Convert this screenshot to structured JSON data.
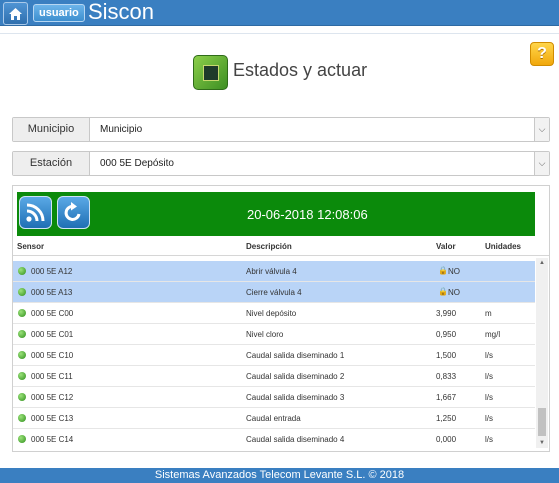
{
  "header": {
    "home_icon": "home-icon",
    "user_label": "usuario",
    "app_title": "Siscon",
    "help_label": "?"
  },
  "page": {
    "icon": "circuit-board-icon",
    "title": "Estados y actuar"
  },
  "filters": {
    "municipio": {
      "label": "Municipio",
      "value": "Municipio"
    },
    "estacion": {
      "label": "Estación",
      "value": "000 5E Depósito"
    }
  },
  "panel": {
    "datetime": "20-06-2018 12:08:06",
    "columns": {
      "sensor": "Sensor",
      "descripcion": "Descripción",
      "valor": "Valor",
      "unidades": "Unidades"
    },
    "rows": [
      {
        "sensor": "000 5E A12",
        "descripcion": "Abrir válvula 4",
        "valor": "NO",
        "unidades": "",
        "selected": true,
        "locked": true
      },
      {
        "sensor": "000 5E A13",
        "descripcion": "Cierre válvula 4",
        "valor": "NO",
        "unidades": "",
        "selected": true,
        "locked": true
      },
      {
        "sensor": "000 5E C00",
        "descripcion": "Nivel depósito",
        "valor": "3,990",
        "unidades": "m"
      },
      {
        "sensor": "000 5E C01",
        "descripcion": "Nivel cloro",
        "valor": "0,950",
        "unidades": "mg/l"
      },
      {
        "sensor": "000 5E C10",
        "descripcion": "Caudal salida diseminado 1",
        "valor": "1,500",
        "unidades": "l/s"
      },
      {
        "sensor": "000 5E C11",
        "descripcion": "Caudal salida diseminado 2",
        "valor": "0,833",
        "unidades": "l/s"
      },
      {
        "sensor": "000 5E C12",
        "descripcion": "Caudal salida diseminado 3",
        "valor": "1,667",
        "unidades": "l/s"
      },
      {
        "sensor": "000 5E C13",
        "descripcion": "Caudal entrada",
        "valor": "1,250",
        "unidades": "l/s"
      },
      {
        "sensor": "000 5E C14",
        "descripcion": "Caudal salida diseminado 4",
        "valor": "0,000",
        "unidades": "l/s"
      }
    ]
  },
  "footer": {
    "text": "Sistemas Avanzados Telecom Levante S.L. © 2018"
  }
}
